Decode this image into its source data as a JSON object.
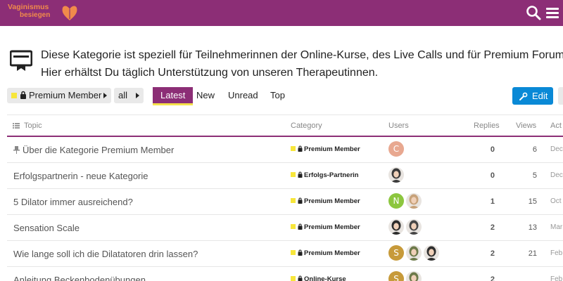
{
  "header": {
    "logo_line1": "Vaginismus",
    "logo_line2": "besiegen",
    "brand_color": "#8c2e76",
    "logo_color": "#f08a4b",
    "icons": [
      "search-icon",
      "menu-icon"
    ]
  },
  "banner": {
    "line1": "Diese Kategorie ist speziell für Teilnehmerinnen der Online-Kurse, des Live Calls und für Premium Forum Member",
    "line2": "Hier erhältst Du täglich Unterstützung von unseren Therapeutinnen.",
    "icon": "badge-icon"
  },
  "nav": {
    "category_crumb": "Premium Member",
    "tag_crumb": "all",
    "tabs": [
      "Latest",
      "New",
      "Unread",
      "Top"
    ],
    "active_tab": "Latest",
    "edit_label": "Edit",
    "edit_color": "#0a89d6"
  },
  "table": {
    "headers": {
      "topic": "Topic",
      "category": "Category",
      "users": "Users",
      "replies": "Replies",
      "views": "Views",
      "activity": "Act"
    },
    "rows": [
      {
        "title": "Über die Kategorie Premium Member",
        "pinned": true,
        "category": "Premium Member",
        "avatars": [
          {
            "type": "letter",
            "letter": "C",
            "color": "#e8a890"
          }
        ],
        "replies": "0",
        "views": "6",
        "activity": "Dec"
      },
      {
        "title": "Erfolgspartnerin - neue Kategorie",
        "pinned": false,
        "category": "Erfolgs-Partnerin",
        "avatars": [
          {
            "type": "photo",
            "color": "#3a3a3a"
          }
        ],
        "replies": "0",
        "views": "5",
        "activity": "Dec"
      },
      {
        "title": "5 Dilator immer ausreichend?",
        "pinned": false,
        "category": "Premium Member",
        "avatars": [
          {
            "type": "letter",
            "letter": "N",
            "color": "#8cc63f"
          },
          {
            "type": "photo",
            "color": "#c7a27a"
          }
        ],
        "replies": "1",
        "views": "15",
        "activity": "Oct"
      },
      {
        "title": "Sensation Scale",
        "pinned": false,
        "category": "Premium Member",
        "avatars": [
          {
            "type": "photo",
            "color": "#2b2b2b"
          },
          {
            "type": "photo",
            "color": "#454545"
          }
        ],
        "replies": "2",
        "views": "13",
        "activity": "Mar"
      },
      {
        "title": "Wie lange soll ich die Dilatatoren drin lassen?",
        "pinned": false,
        "category": "Premium Member",
        "avatars": [
          {
            "type": "letter",
            "letter": "S",
            "color": "#c79a3a"
          },
          {
            "type": "photo",
            "color": "#6d7a4a"
          },
          {
            "type": "photo",
            "color": "#2e2e2e"
          }
        ],
        "replies": "2",
        "views": "21",
        "activity": "Feb"
      },
      {
        "title": "Anleitung Beckenbodenübungen",
        "pinned": false,
        "category": "Online-Kurse",
        "avatars": [
          {
            "type": "letter",
            "letter": "S",
            "color": "#c79a3a"
          },
          {
            "type": "photo",
            "color": "#6d7a4a"
          }
        ],
        "replies": "2",
        "views": "",
        "activity": "Feb"
      }
    ]
  }
}
